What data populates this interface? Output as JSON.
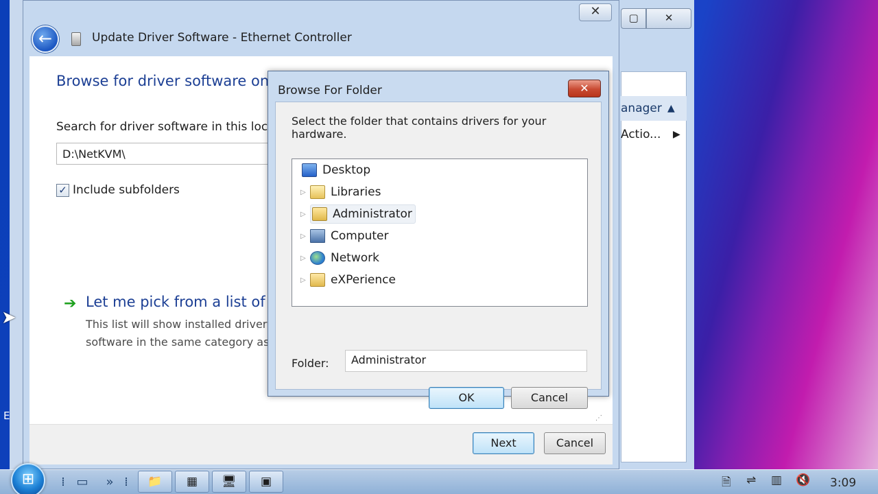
{
  "background_window": {
    "header_label": "anager",
    "action_label": "Actio..."
  },
  "wizard": {
    "title": "Update Driver Software - Ethernet Controller",
    "heading": "Browse for driver software on",
    "search_label": "Search for driver software in this locatio",
    "path_value": "D:\\NetKVM\\",
    "include_subfolders_label": "Include subfolders",
    "include_subfolders_checked": true,
    "pick_title": "Let me pick from a list of",
    "pick_desc_line1": "This list will show installed driver s",
    "pick_desc_line2": "software in the same category as",
    "next_label": "Next",
    "cancel_label": "Cancel"
  },
  "dialog": {
    "title": "Browse For Folder",
    "instruction": "Select the folder that contains drivers for your hardware.",
    "tree": [
      {
        "label": "Desktop",
        "icon": "desktop-icon",
        "expandable": false
      },
      {
        "label": "Libraries",
        "icon": "libraries-icon",
        "expandable": true
      },
      {
        "label": "Administrator",
        "icon": "user-folder-icon",
        "expandable": true,
        "selected": true
      },
      {
        "label": "Computer",
        "icon": "computer-icon",
        "expandable": true
      },
      {
        "label": "Network",
        "icon": "network-icon",
        "expandable": true
      },
      {
        "label": "eXPerience",
        "icon": "folder-icon",
        "expandable": true
      }
    ],
    "folder_label": "Folder:",
    "folder_value": "Administrator",
    "ok_label": "OK",
    "cancel_label": "Cancel"
  },
  "taskbar": {
    "clock": "3:09"
  },
  "desktop_edge_text": "E"
}
